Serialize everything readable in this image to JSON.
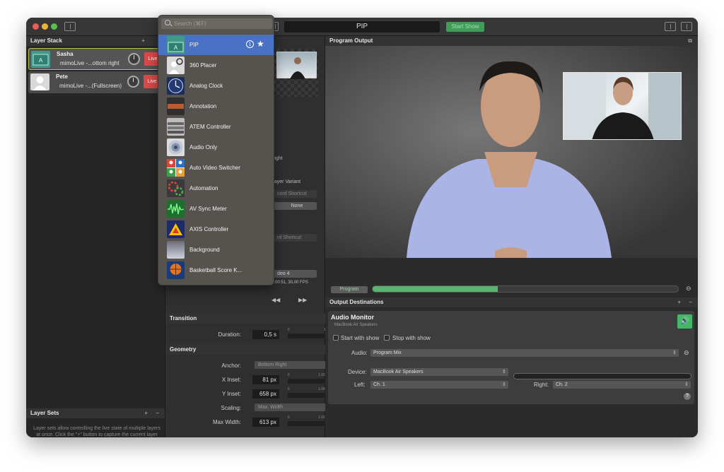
{
  "window": {
    "title": "PIP",
    "start_show": "Start Show"
  },
  "layer_stack": {
    "title": "Layer Stack",
    "layers": [
      {
        "name": "Sasha",
        "subtitle": "mimoLive -...ottom right",
        "live": "Live"
      },
      {
        "name": "Pete",
        "subtitle": "mimoLive -...(Fullscreen)",
        "live": "Live"
      }
    ]
  },
  "layer_sets": {
    "title": "Layer Sets",
    "description": "Layer sets allow controlling the live state of multiple layers at once. Click the \"+\" button to capture the current layer stack in a new layer set."
  },
  "search": {
    "placeholder": "Search (⌘F)"
  },
  "sources": [
    {
      "label": "PIP"
    },
    {
      "label": "360 Placer"
    },
    {
      "label": "Analog Clock"
    },
    {
      "label": "Annotation"
    },
    {
      "label": "ATEM Controller"
    },
    {
      "label": "Audio Only"
    },
    {
      "label": "Auto Video Switcher"
    },
    {
      "label": "Automation"
    },
    {
      "label": "AV Sync Meter"
    },
    {
      "label": "AXIS Controller"
    },
    {
      "label": "Background"
    },
    {
      "label": "Basketball Score K..."
    }
  ],
  "middle": {
    "right_label": "right",
    "layer_variant": "Layer Variant",
    "record_shortcut": "cord Shortcut",
    "none": "None",
    "shortcut2": "rd Shortcut",
    "video_select": "deo 4",
    "timecode": "0:00:51, 30,00 FPS",
    "transition": {
      "title": "Transition",
      "duration_label": "Duration:",
      "duration_value": "0,5 s",
      "min": "0",
      "max": "10"
    },
    "geometry": {
      "title": "Geometry",
      "anchor_label": "Anchor:",
      "anchor_value": "Bottom Right",
      "x_label": "X Inset:",
      "x_value": "81 px",
      "x_min": "0",
      "x_max": "1.920",
      "y_label": "Y Inset:",
      "y_value": "658 px",
      "y_min": "0",
      "y_max": "1.080",
      "scaling_label": "Scaling:",
      "scaling_value": "Max. Width",
      "maxw_label": "Max Width:",
      "maxw_value": "613 px",
      "maxw_min": "0",
      "maxw_max": "1.920"
    }
  },
  "program": {
    "title": "Program Output",
    "button": "Program",
    "progress": 0.41
  },
  "outputs": {
    "title": "Output Destinations",
    "audio_monitor": {
      "title": "Audio Monitor",
      "device_sub": "MacBook Air Speakers",
      "start_with_show": "Start with show",
      "stop_with_show": "Stop with show",
      "audio_label": "Audio:",
      "audio_value": "Program Mix",
      "device_label": "Device:",
      "device_value": "MacBook Air Speakers",
      "left_label": "Left:",
      "left_value": "Ch. 1",
      "right_label": "Right:",
      "right_value": "Ch. 2"
    }
  },
  "colors": {
    "accent_selection": "#4a72c4",
    "live_red": "#d94a4a",
    "start_green": "#3f9d58",
    "meter_green": "#58b46e"
  }
}
